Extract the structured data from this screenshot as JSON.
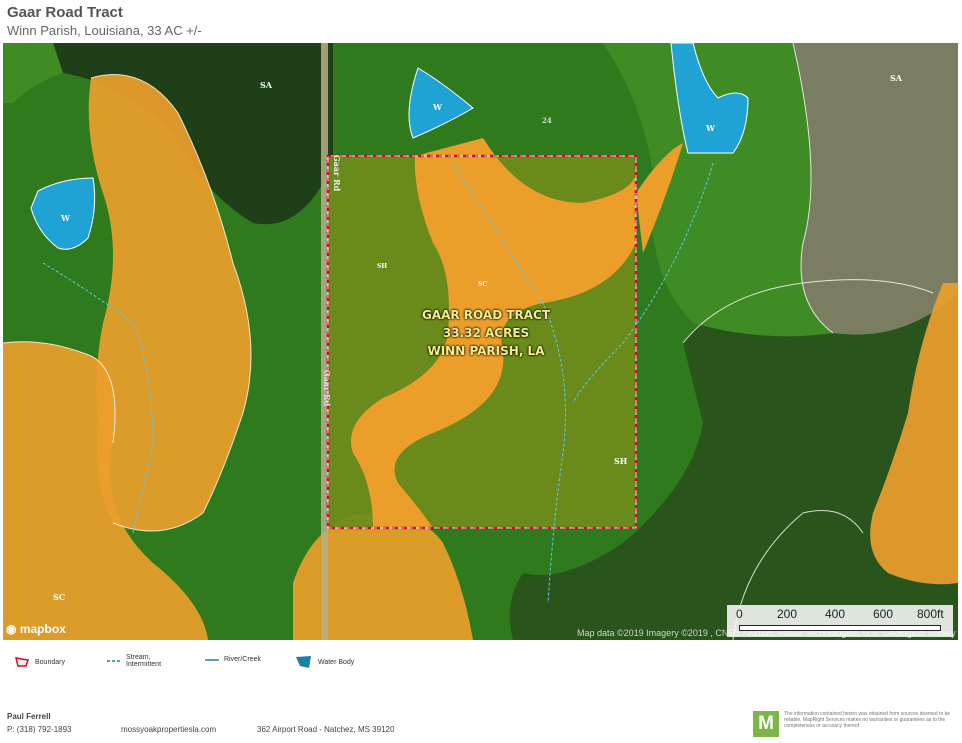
{
  "header": {
    "title": "Gaar Road Tract",
    "subtitle": "Winn Parish, Louisiana, 33 AC +/-"
  },
  "map": {
    "tract_label": [
      "GAAR ROAD TRACT",
      "33.32 ACRES",
      "WINN PARISH, LA"
    ],
    "soil_labels": {
      "sa_top": "SA",
      "sa_right": "SA",
      "w_left": "W",
      "w_center": "W",
      "w_right": "W",
      "sh_inner": "SH",
      "sc_inner": "SC",
      "sh_right": "SH",
      "sc_bottom_left": "SC"
    },
    "road_labels": {
      "road_a": "Gaar Rd",
      "road_b": "Gaar Rd",
      "route": "24"
    },
    "logo": "mapbox",
    "attribution": "Map data ©2019 Imagery ©2019 , CNES / Airbus, Maxar Technologies, U.S. Geological Survey",
    "scale": {
      "labels": [
        "0",
        "200",
        "400",
        "600",
        "800ft"
      ]
    },
    "colors": {
      "soil_sc": "#f0a830",
      "soil_sh": "#6b8c1f",
      "water": "#1fa3d4",
      "boundary": "#c8102e",
      "forest": "#2e6b1a"
    }
  },
  "legend": [
    {
      "label": "Boundary",
      "icon": "boundary-icon"
    },
    {
      "label": "Stream, Intermittent",
      "icon": "stream-intermittent-icon"
    },
    {
      "label": "River/Creek",
      "icon": "river-creek-icon"
    },
    {
      "label": "Water Body",
      "icon": "water-body-icon"
    }
  ],
  "footer": {
    "name": "Paul Ferrell",
    "phone": "P: (318) 792-1893",
    "website": "mossyoakpropertiesla.com",
    "address": "362 Airport Road - Natchez, MS 39120",
    "logo_letter": "M",
    "disclaimer": "The information contained herein was obtained from sources deemed to be reliable. MapRight Services makes no warranties or guarantees as to the completeness or accuracy thereof."
  }
}
